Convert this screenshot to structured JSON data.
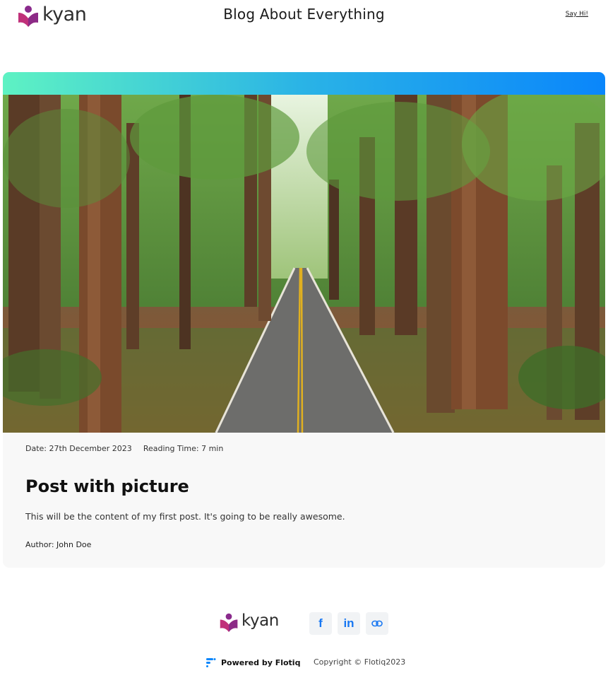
{
  "header": {
    "logo_text": "kyan",
    "site_title": "Blog About Everything",
    "say_hi": "Say Hi!"
  },
  "post": {
    "image_alt": "Road through redwood forest",
    "date": "Date: 27th December 2023",
    "reading_time": "Reading Time: 7 min",
    "title": "Post with picture",
    "content": "This will be the content of my first post. It's going to be really awesome.",
    "author": "Author: John Doe"
  },
  "footer": {
    "logo_text": "kyan",
    "social": [
      {
        "icon": "facebook-icon"
      },
      {
        "icon": "linkedin-icon"
      },
      {
        "icon": "link-icon"
      }
    ],
    "powered_by": "Powered by Flotiq",
    "copyright": "Copyright © Flotiq2023"
  },
  "colors": {
    "gradient_start": "#5ef2c3",
    "gradient_end": "#0a86fb",
    "logo_magenta": "#c0307a",
    "logo_purple": "#7a2a8a",
    "social_blue": "#1877f2"
  }
}
